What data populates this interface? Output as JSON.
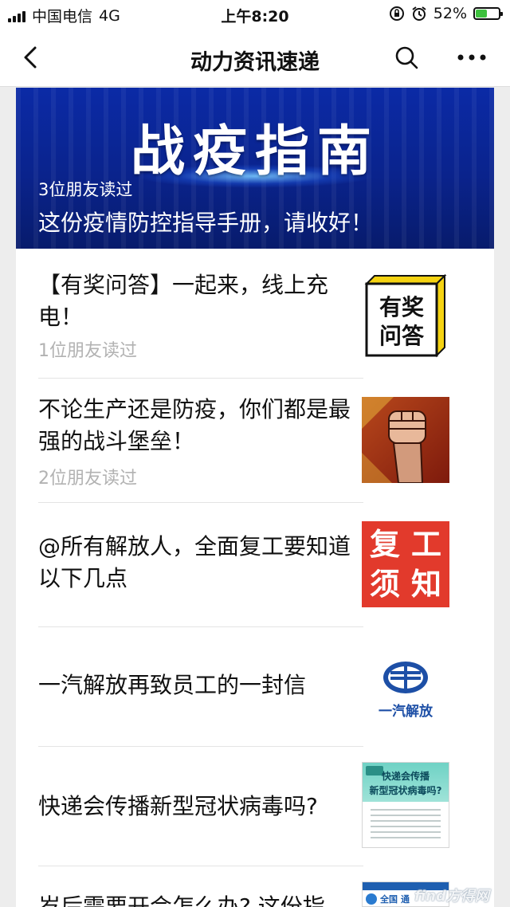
{
  "status_bar": {
    "carrier": "中国电信",
    "network": "4G",
    "time": "上午8:20",
    "battery": "52%"
  },
  "nav": {
    "title": "动力资讯速递"
  },
  "banner": {
    "heading": "战疫指南",
    "readers": "3位朋友读过",
    "subtitle": "这份疫情防控指导手册，请收好！"
  },
  "articles": [
    {
      "title": "【有奖问答】一起来，线上充电！",
      "readers": "1位朋友读过",
      "thumb_text": [
        "有奖",
        "问答"
      ]
    },
    {
      "title": "不论生产还是防疫，你们都是最强的战斗堡垒！",
      "readers": "2位朋友读过"
    },
    {
      "title": "@所有解放人，全面复工要知道以下几点",
      "thumb_text": [
        "复",
        "工",
        "须",
        "知"
      ]
    },
    {
      "title": "一汽解放再致员工的一封信",
      "thumb_text": [
        "一汽解放"
      ]
    },
    {
      "title": "快递会传播新型冠状病毒吗?",
      "thumb_text": [
        "快递会传播",
        "新型冠状病毒吗?"
      ]
    },
    {
      "title": "岁后需要开会怎么办? 这份指",
      "thumb_text": [
        "全国",
        "通"
      ]
    }
  ],
  "watermark": "find方得网",
  "colors": {
    "banner": "#0a238c",
    "battery": "#3ec13e",
    "fupai_red": "#e23a2c",
    "faw_blue": "#1d4fa6"
  }
}
